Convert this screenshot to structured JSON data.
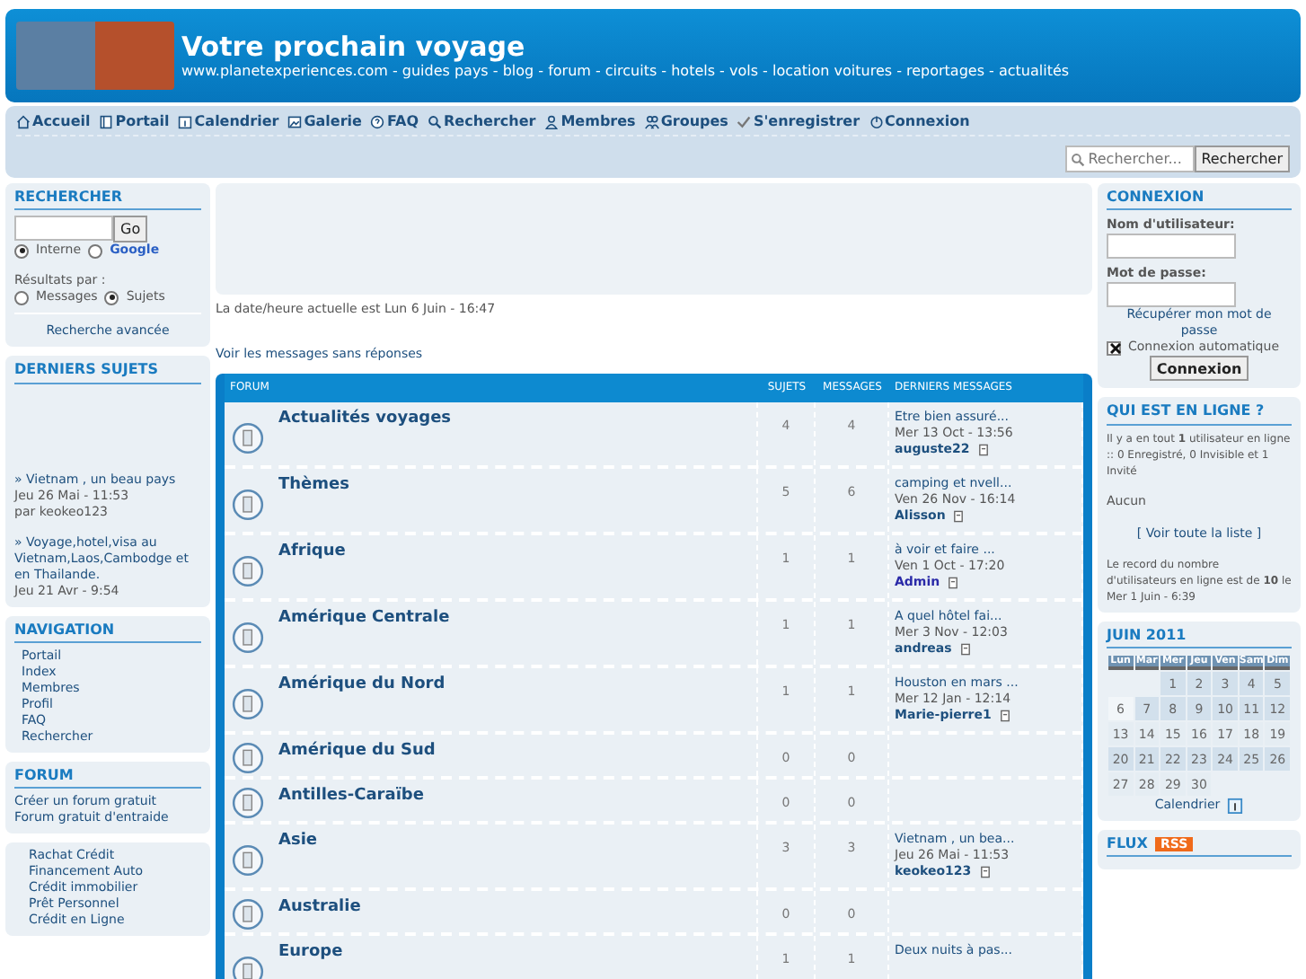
{
  "header": {
    "title": "Votre prochain voyage",
    "links": "www.planetexperiences.com - guides pays - blog - forum - circuits - hotels - vols - location voitures - reportages - actualités"
  },
  "nav": {
    "items": [
      "Accueil",
      "Portail",
      "Calendrier",
      "Galerie",
      "FAQ",
      "Rechercher",
      "Membres",
      "Groupes",
      "S'enregistrer",
      "Connexion"
    ],
    "search": {
      "placeholder": "Rechercher...",
      "button": "Rechercher"
    }
  },
  "left": {
    "search": {
      "title": "RECHERCHER",
      "button": "Go",
      "engines": [
        {
          "label": "Interne",
          "selected": true
        },
        {
          "label": "Google",
          "selected": false
        }
      ],
      "results_label": "Résultats par :",
      "results": [
        {
          "label": "Messages",
          "selected": false
        },
        {
          "label": "Sujets",
          "selected": true
        }
      ],
      "advanced": "Recherche avancée"
    },
    "latest": {
      "title": "DERNIERS SUJETS",
      "items": [
        {
          "title": "» Vietnam , un beau pays",
          "date": "Jeu 26 Mai - 11:53",
          "author": "par keokeo123"
        },
        {
          "title": "» Voyage,hotel,visa au Vietnam,Laos,Cambodge et en Thailande.",
          "date": "Jeu 21 Avr - 9:54"
        }
      ]
    },
    "navigation": {
      "title": "NAVIGATION",
      "items": [
        "Portail",
        "Index",
        "Membres",
        "Profil",
        "FAQ",
        "Rechercher"
      ]
    },
    "forum": {
      "title": "FORUM",
      "items": [
        "Créer un forum gratuit",
        "Forum gratuit d'entraide"
      ]
    },
    "ads": [
      "Rachat Crédit",
      "Financement Auto",
      "Crédit immobilier",
      "Prêt Personnel",
      "Crédit en Ligne"
    ]
  },
  "main": {
    "datetime": "La date/heure actuelle est Lun 6 Juin - 16:47",
    "unanswered": "Voir les messages sans réponses",
    "table": {
      "columns": [
        "FORUM",
        "SUJETS",
        "MESSAGES",
        "DERNIERS MESSAGES"
      ],
      "rows": [
        {
          "name": "Actualités voyages",
          "topics": "4",
          "messages": "4",
          "last": {
            "title": "Etre bien assuré...",
            "date": "Mer 13 Oct - 13:56",
            "author": "auguste22",
            "color": "#1d4f7e"
          }
        },
        {
          "name": "Thèmes",
          "topics": "5",
          "messages": "6",
          "last": {
            "title": "camping et nvell...",
            "date": "Ven 26 Nov - 16:14",
            "author": "Alisson",
            "color": "#1d4f7e"
          }
        },
        {
          "name": "Afrique",
          "topics": "1",
          "messages": "1",
          "last": {
            "title": "à voir et faire ...",
            "date": "Ven 1 Oct - 17:20",
            "author": "Admin",
            "color": "#2a2aa8"
          }
        },
        {
          "name": "Amérique Centrale",
          "topics": "1",
          "messages": "1",
          "last": {
            "title": "A quel hôtel fai...",
            "date": "Mer 3 Nov - 12:03",
            "author": "andreas",
            "color": "#1d4f7e"
          }
        },
        {
          "name": "Amérique du Nord",
          "topics": "1",
          "messages": "1",
          "last": {
            "title": "Houston en mars ...",
            "date": "Mer 12 Jan - 12:14",
            "author": "Marie-pierre1",
            "color": "#1d4f7e"
          }
        },
        {
          "name": "Amérique du Sud",
          "topics": "0",
          "messages": "0"
        },
        {
          "name": "Antilles-Caraïbe",
          "topics": "0",
          "messages": "0"
        },
        {
          "name": "Asie",
          "topics": "3",
          "messages": "3",
          "last": {
            "title": "Vietnam , un bea...",
            "date": "Jeu 26 Mai - 11:53",
            "author": "keokeo123",
            "color": "#1d4f7e"
          }
        },
        {
          "name": "Australie",
          "topics": "0",
          "messages": "0"
        },
        {
          "name": "Europe",
          "topics": "1",
          "messages": "1",
          "last": {
            "title": "Deux nuits à pas..."
          }
        }
      ]
    }
  },
  "right": {
    "login": {
      "title": "CONNEXION",
      "user_label": "Nom d'utilisateur:",
      "pass_label": "Mot de passe:",
      "recover": "Récupérer mon mot de passe",
      "auto": {
        "label": "Connexion automatique",
        "checked": true
      },
      "button": "Connexion"
    },
    "online": {
      "title": "QUI EST EN LIGNE ?",
      "summary": "Il y a en tout **1** utilisateur en ligne :: 0 Enregistré, 0 Invisible et 1 Invité",
      "users": "Aucun",
      "list_link": "[ Voir toute la liste ]",
      "record": "Le record du nombre d'utilisateurs en ligne est de **10** le Mer 1 Juin - 6:39"
    },
    "calendar": {
      "title": "JUIN 2011",
      "weekdays": [
        "Lun",
        "Mar",
        "Mer",
        "Jeu",
        "Ven",
        "Sam",
        "Dim"
      ],
      "weeks": [
        {
          "shaded": true,
          "days": [
            {
              "day": "1"
            },
            {
              "day": "2"
            },
            {
              "day": "3"
            },
            {
              "day": "4"
            },
            {
              "day": "5"
            }
          ]
        },
        {
          "shaded": true,
          "days": [
            {
              "day": "6",
              "today": true
            },
            {
              "day": "7"
            },
            {
              "day": "8"
            },
            {
              "day": "9"
            },
            {
              "day": "10"
            },
            {
              "day": "11"
            },
            {
              "day": "12"
            }
          ]
        },
        {
          "shaded": false,
          "days": [
            {
              "day": "13"
            },
            {
              "day": "14"
            },
            {
              "day": "15"
            },
            {
              "day": "16"
            },
            {
              "day": "17"
            },
            {
              "day": "18"
            },
            {
              "day": "19"
            }
          ]
        },
        {
          "shaded": true,
          "days": [
            {
              "day": "20"
            },
            {
              "day": "21"
            },
            {
              "day": "22"
            },
            {
              "day": "23"
            },
            {
              "day": "24"
            },
            {
              "day": "25"
            },
            {
              "day": "26"
            }
          ]
        },
        {
          "shaded": false,
          "days": [
            {
              "day": "27"
            },
            {
              "day": "28"
            },
            {
              "day": "29"
            },
            {
              "day": "30"
            }
          ]
        }
      ],
      "link": "Calendrier"
    },
    "feed": {
      "title": "FLUX",
      "badge": "RSS"
    }
  }
}
